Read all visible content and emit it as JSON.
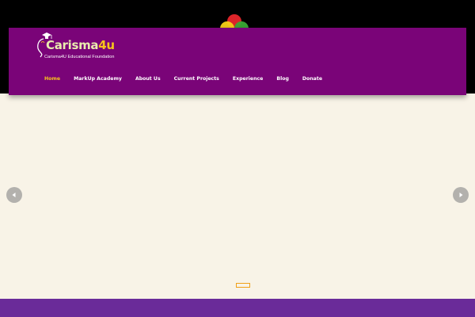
{
  "brand": {
    "name_main": "Carisma",
    "name_accent": "4u",
    "tagline": "Carisma4U Educational Foundation"
  },
  "nav": {
    "items": [
      {
        "label": "Home",
        "active": true
      },
      {
        "label": "MarkUp Academy",
        "active": false
      },
      {
        "label": "About Us",
        "active": false
      },
      {
        "label": "Current Projects",
        "active": false
      },
      {
        "label": "Experience",
        "active": false
      },
      {
        "label": "Blog",
        "active": false
      },
      {
        "label": "Donate",
        "active": false
      }
    ]
  },
  "slider": {
    "prev_icon": "chevron-left-icon",
    "next_icon": "chevron-right-icon",
    "slide_count": 1,
    "active_slide": 1
  },
  "loader": {
    "icon": "loading-dots-icon",
    "colors": [
      "#e8262b",
      "#f7d018",
      "#39a935"
    ]
  },
  "colors": {
    "header_bg": "#7a0478",
    "top_bg": "#000000",
    "page_bg": "#f8f3e7",
    "accent": "#f7c51b",
    "footer_band": "#6a2b99",
    "slide_indicator": "#f0a018"
  }
}
